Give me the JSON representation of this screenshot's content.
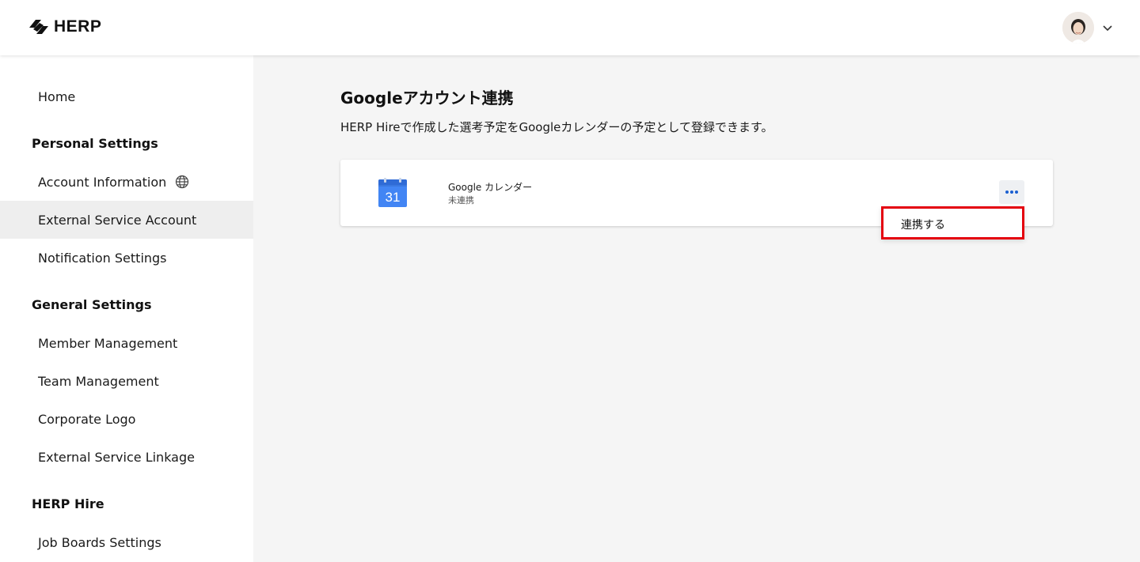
{
  "header": {
    "logo_text": "HERP",
    "user_avatar": "avatar",
    "menu_icon": "chevron-down-icon"
  },
  "sidebar": {
    "home": "Home",
    "personal_settings": {
      "heading": "Personal Settings",
      "items": [
        {
          "label": "Account Information",
          "icon": "globe-icon"
        },
        {
          "label": "External Service Account",
          "active": true
        },
        {
          "label": "Notification Settings"
        }
      ]
    },
    "general_settings": {
      "heading": "General Settings",
      "items": [
        {
          "label": "Member Management"
        },
        {
          "label": "Team Management"
        },
        {
          "label": "Corporate Logo"
        },
        {
          "label": "External Service Linkage"
        }
      ]
    },
    "herp_hire": {
      "heading": "HERP Hire",
      "items": [
        {
          "label": "Job Boards Settings"
        }
      ]
    }
  },
  "main": {
    "title": "Googleアカウント連携",
    "description": "HERP Hireで作成した選考予定をGoogleカレンダーの予定として登録できます。",
    "service": {
      "name": "Google カレンダー",
      "status": "未連携",
      "icon": "google-calendar-icon",
      "calendar_number": "31",
      "more_icon": "more-dots-icon"
    },
    "dropdown": {
      "items": [
        "連携する"
      ]
    }
  },
  "colors": {
    "highlight_border": "#e4000f",
    "accent_blue": "#1a5fd1",
    "calendar_blue": "#4285f4",
    "active_nav_bg": "#eeeeee"
  }
}
